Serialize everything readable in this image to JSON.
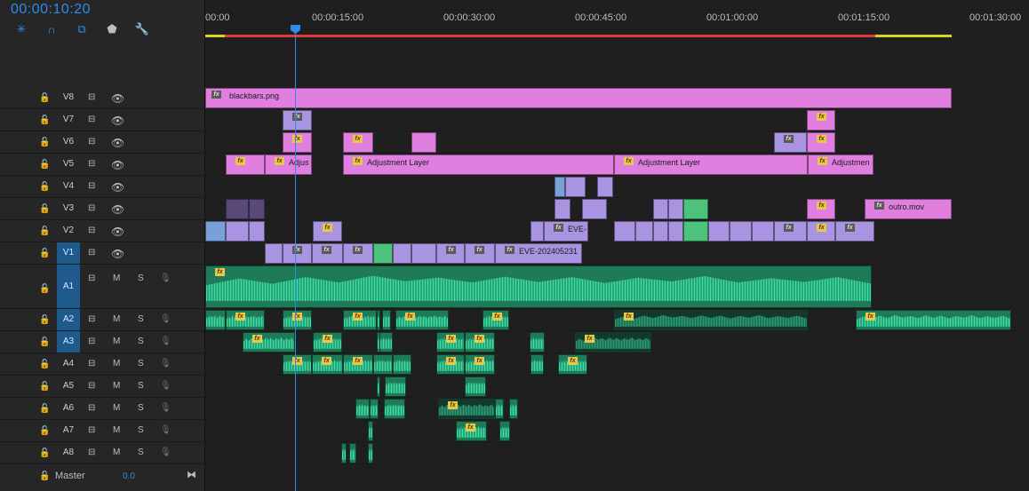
{
  "timecode": "00:00:10:20",
  "tools": [
    {
      "name": "nest-icon",
      "glyph": "✳"
    },
    {
      "name": "snap-icon",
      "glyph": "∩"
    },
    {
      "name": "linked-selection-icon",
      "glyph": "⧉"
    },
    {
      "name": "add-marker-icon",
      "glyph": "⬟"
    },
    {
      "name": "wrench-icon",
      "glyph": "🔧"
    }
  ],
  "ruler": [
    "00:00",
    "00:00:15:00",
    "00:00:30:00",
    "00:00:45:00",
    "00:01:00:00",
    "00:01:15:00",
    "00:01:30:00"
  ],
  "video_tracks": [
    "V8",
    "V7",
    "V6",
    "V5",
    "V4",
    "V3",
    "V2",
    "V1"
  ],
  "audio_tracks": [
    "A1",
    "A2",
    "A3",
    "A4",
    "A5",
    "A6",
    "A7",
    "A8"
  ],
  "master": {
    "label": "Master",
    "value": "0.0"
  },
  "clip_labels": {
    "v8": "blackbars.png",
    "v5a": "Adjus",
    "v5b": "Adjustment Layer",
    "v5c": "Adjustment Layer",
    "v5d": "Adjustmen",
    "v3": "outro.mov",
    "v2": "EVE-",
    "v1": "EVE-202405231"
  },
  "colors": {
    "video": "#e07fe0",
    "video2": "#a894e0",
    "audio": "#1f7a58",
    "playhead": "#2d8ceb",
    "accent": "#1f5a8c"
  }
}
